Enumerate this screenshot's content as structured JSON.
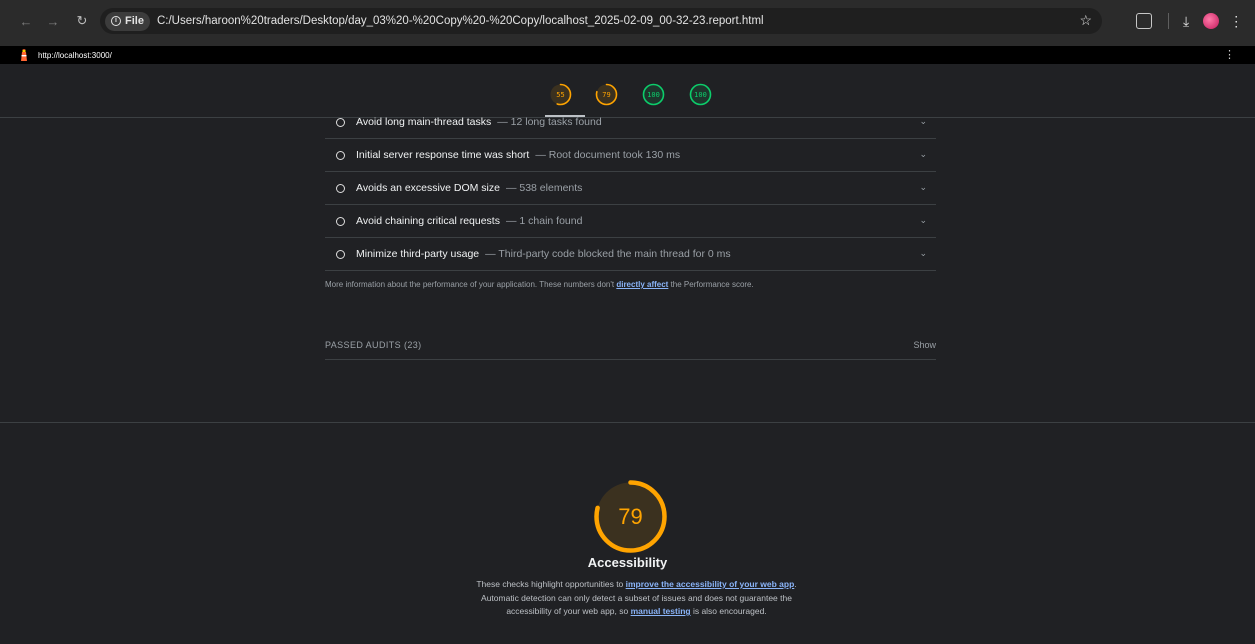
{
  "browser": {
    "chip_label": "File",
    "url": "C:/Users/haroon%20traders/Desktop/day_03%20-%20Copy%20-%20Copy/localhost_2025-02-09_00-32-23.report.html"
  },
  "topbar": {
    "url": "http://localhost:3000/"
  },
  "gauges": [
    {
      "label": "55",
      "score": 55,
      "color": "#ffa400"
    },
    {
      "label": "79",
      "score": 79,
      "color": "#ffa400"
    },
    {
      "label": "100",
      "score": 100,
      "color": "#0cce6b"
    },
    {
      "label": "100",
      "score": 100,
      "color": "#0cce6b"
    }
  ],
  "audits": [
    {
      "title": "Avoid long main-thread tasks",
      "desc": "— 12 long tasks found"
    },
    {
      "title": "Initial server response time was short",
      "desc": "— Root document took 130 ms"
    },
    {
      "title": "Avoids an excessive DOM size",
      "desc": "— 538 elements"
    },
    {
      "title": "Avoid chaining critical requests",
      "desc": "— 1 chain found"
    },
    {
      "title": "Minimize third-party usage",
      "desc": "— Third-party code blocked the main thread for 0 ms"
    }
  ],
  "more_info": {
    "before": "More information about the performance of your application. These numbers don't ",
    "link": "directly affect",
    "after": " the Performance score."
  },
  "passed": {
    "label": "PASSED AUDITS (23)",
    "show": "Show"
  },
  "accessibility": {
    "score": 79,
    "score_label": "79",
    "color": "#ffa400",
    "title": "Accessibility",
    "desc_1": "These checks highlight opportunities to ",
    "link_1": "improve the accessibility of your web app",
    "desc_2": ". Automatic detection can only detect a subset of issues and does not guarantee the accessibility of your web app, so ",
    "link_2": "manual testing",
    "desc_3": " is also encouraged."
  },
  "colors": {
    "background": "#202124",
    "average": "#ffa400",
    "pass": "#0cce6b",
    "link": "#8ab4f8"
  }
}
